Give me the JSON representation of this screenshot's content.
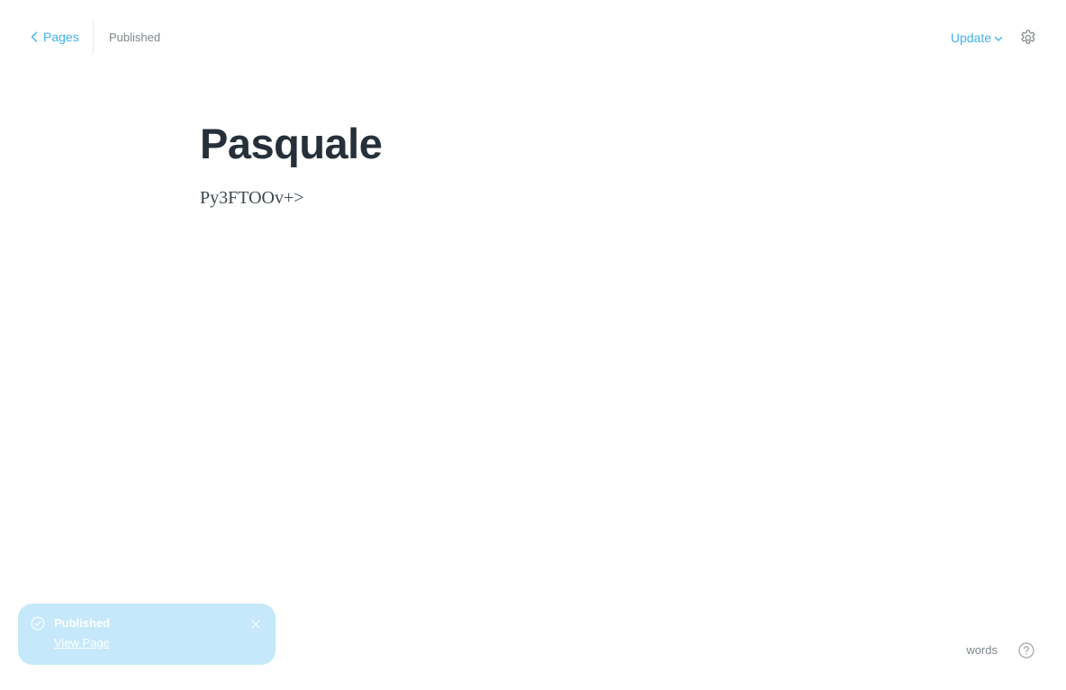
{
  "header": {
    "back_label": "Pages",
    "status": "Published",
    "update_label": "Update"
  },
  "editor": {
    "title": "Pasquale",
    "body": "Py3FTOOv+>"
  },
  "notification": {
    "title": "Published",
    "link_label": "View Page"
  },
  "footer": {
    "word_count_label": "words"
  },
  "colors": {
    "accent": "#3eb0ef",
    "notification_bg": "#c5e8fb",
    "title_text": "#26303a",
    "muted_text": "#7d878a"
  },
  "icons": {
    "back": "chevron-left-icon",
    "update": "chevron-down-icon",
    "settings": "gear-icon",
    "notification_status": "check-circle-icon",
    "notification_close": "close-icon",
    "help": "question-circle-icon"
  }
}
